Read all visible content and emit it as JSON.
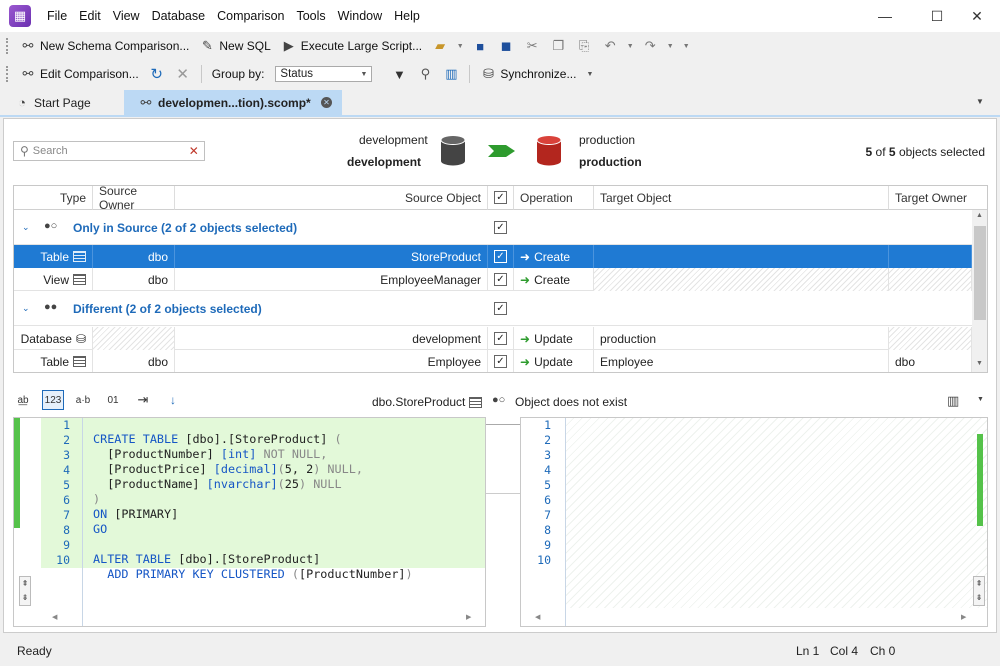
{
  "menu": [
    "File",
    "Edit",
    "View",
    "Database",
    "Comparison",
    "Tools",
    "Window",
    "Help"
  ],
  "toolbar1": {
    "new_schema_comparison": "New Schema Comparison...",
    "new_sql": "New SQL",
    "execute_large_script": "Execute Large Script..."
  },
  "toolbar2": {
    "edit_comparison": "Edit Comparison...",
    "group_by_label": "Group by:",
    "group_by_value": "Status",
    "synchronize": "Synchronize..."
  },
  "tabs": {
    "start_page": "Start Page",
    "comparison": "developmen...tion).scomp*"
  },
  "search": {
    "placeholder": "Search"
  },
  "source": {
    "name": "development",
    "db": "development"
  },
  "target": {
    "name": "production",
    "db": "production"
  },
  "selection": {
    "count": "5",
    "of": "of",
    "total": "5",
    "suffix": "objects selected"
  },
  "columns": {
    "type": "Type",
    "source_owner": "Source Owner",
    "source_object": "Source Object",
    "operation": "Operation",
    "target_object": "Target Object",
    "target_owner": "Target Owner"
  },
  "groups": [
    {
      "title": "Only in Source (2 of 2 objects selected)"
    },
    {
      "title": "Different (2 of 2 objects selected)"
    }
  ],
  "rows": [
    {
      "type": "Table",
      "source_owner": "dbo",
      "source_object": "StoreProduct",
      "operation": "Create",
      "target_object": "",
      "target_owner": ""
    },
    {
      "type": "View",
      "source_owner": "dbo",
      "source_object": "EmployeeManager",
      "operation": "Create",
      "target_object": "",
      "target_owner": ""
    },
    {
      "type": "Database",
      "source_owner": "",
      "source_object": "development",
      "operation": "Update",
      "target_object": "production",
      "target_owner": ""
    },
    {
      "type": "Table",
      "source_owner": "dbo",
      "source_object": "Employee",
      "operation": "Update",
      "target_object": "Employee",
      "target_owner": "dbo"
    }
  ],
  "editor": {
    "left_title": "dbo.StoreProduct",
    "right_title": "Object does not exist",
    "line_numbers": [
      "1",
      "2",
      "3",
      "4",
      "5",
      "6",
      "7",
      "8",
      "9",
      "10"
    ]
  },
  "status": {
    "ready": "Ready",
    "ln": "Ln 1",
    "col": "Col 4",
    "ch": "Ch 0"
  },
  "colors": {
    "accent": "#1f7ad3",
    "group_title": "#1e6ab9",
    "added_bg": "#e3f9d9",
    "change_bar": "#55c24a"
  }
}
